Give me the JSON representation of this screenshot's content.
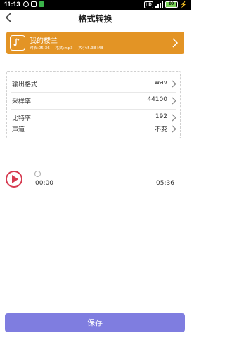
{
  "status_bar": {
    "time": "11:13",
    "hd_label": "HD",
    "battery_level": "99",
    "battery_color": "#7bd35a"
  },
  "header": {
    "back_icon": "chevron-left-icon",
    "title": "格式转换"
  },
  "song": {
    "name": "我的楼兰",
    "duration_label": "时长:05:36",
    "format_label": "格式:mp3",
    "size_label": "大小:5.38 MB",
    "card_color": "#e39425",
    "icon": "music-note-icon"
  },
  "settings": [
    {
      "key": "output",
      "label": "输出格式",
      "value": "wav"
    },
    {
      "key": "samplerate",
      "label": "采样率",
      "value": "44100"
    },
    {
      "key": "bitrate",
      "label": "比特率",
      "value": "192"
    },
    {
      "key": "channel",
      "label": "声道",
      "value": "不变"
    }
  ],
  "player": {
    "current_time": "00:00",
    "total_time": "05:36",
    "progress": 0,
    "accent_color": "#d63a50"
  },
  "save_button": {
    "label": "保存",
    "color": "#7f7de0"
  }
}
